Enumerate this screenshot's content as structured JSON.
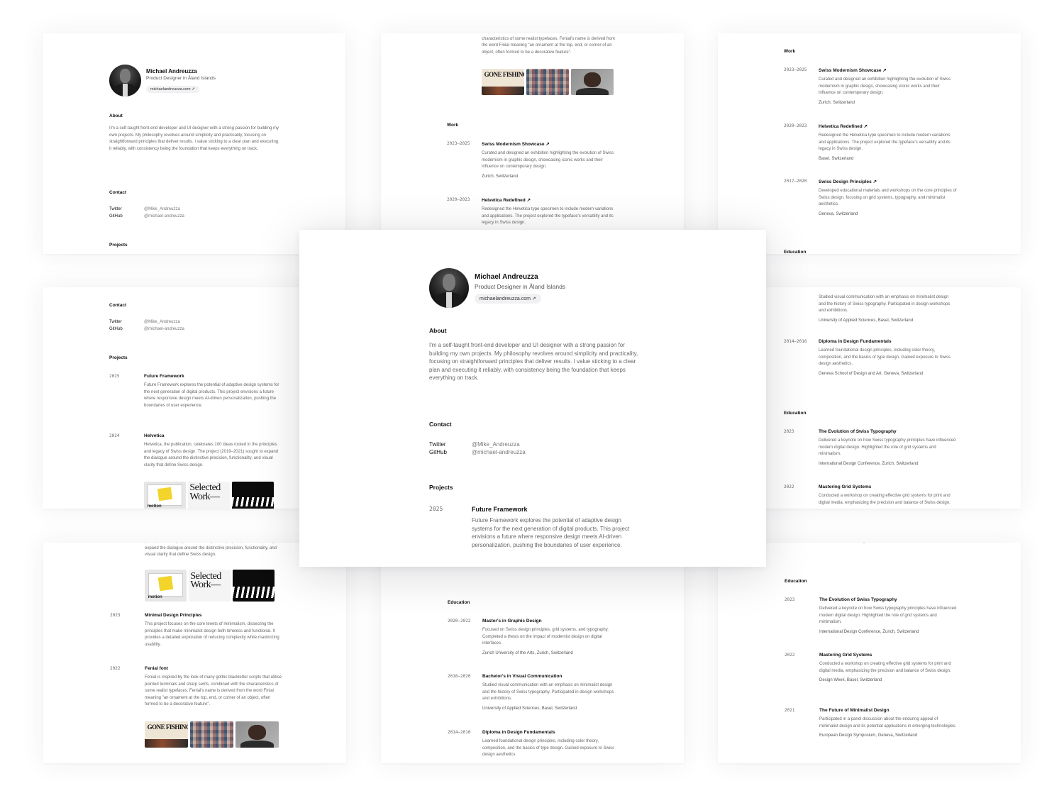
{
  "profile": {
    "name": "Michael Andreuzza",
    "role": "Product Designer in Åland Islands",
    "link": "michaelandreuzza.com ↗"
  },
  "sections": {
    "about": "About",
    "contact": "Contact",
    "projects": "Projects",
    "work": "Work",
    "education": "Education"
  },
  "about": {
    "text": "I'm a self-taught front-end developer and UI designer with a strong passion for building my own projects. My philosophy revolves around simplicity and practicality, focusing on straightforward principles that deliver results. I value sticking to a clear plan and executing it reliably, with consistency being the foundation that keeps everything on track."
  },
  "contact": {
    "twitter_label": "Twitter",
    "twitter_value": "@Mike_Andreuzza",
    "github_label": "GitHub",
    "github_value": "@michael-andreuzza"
  },
  "projects": [
    {
      "year": "2025",
      "title": "Future Framework",
      "desc": "Future Framework explores the potential of adaptive design systems for the next generation of digital products. This project envisions a future where responsive design meets AI-driven personalization, pushing the boundaries of user experience."
    },
    {
      "year": "2024",
      "title": "Helvetica",
      "desc": "Helvetica, the publication, celebrates 100 ideas rooted in the principles and legacy of Swiss design. The project (2019–2021) sought to expand the dialogue around the distinctive precision, functionality, and visual clarity that define Swiss design.",
      "desc_top": "principles and legacy of Swiss design. The project (2019–2021) sought to expand the dialogue around the distinctive precision, functionality, and visual clarity that define Swiss design."
    },
    {
      "year": "2023",
      "title": "Minimal Design Principles",
      "desc": "This project focuses on the core tenets of minimalism, dissecting the principles that make minimalist design both timeless and functional. It provides a detailed exploration of reducing complexity while maximizing usability."
    },
    {
      "year": "2022",
      "title": "Fenial font",
      "desc": "Fenial is inspired by the look of many gothic blackletter scripts that utilise pointed terminals and sharp serifs, combined with the characteristics of some realist typefaces. Fenial's name is derived from the word Finial meaning \"an ornament at the top, end, or corner of an object, often formed to be a decorative feature\".",
      "desc_top": "scripts that utilise pointed terminals and sharp serifs, combined with the characteristics of some realist typefaces. Fenial's name is derived from the word Finial meaning \"an ornament at the top, end, or corner of an object, often formed to be a decorative feature\"."
    }
  ],
  "images": {
    "gone_fishing": "GONE FISHING",
    "motion": "motion",
    "selected_work": "Selected Work—"
  },
  "work": [
    {
      "year": "2023–2025",
      "title": "Swiss Modernism Showcase ↗",
      "desc": "Curated and designed an exhibition highlighting the evolution of Swiss modernism in graphic design, showcasing iconic works and their influence on contemporary design.",
      "loc": "Zurich, Switzerland"
    },
    {
      "year": "2020–2023",
      "title": "Helvetica Redefined ↗",
      "desc": "Redesigned the Helvetica type specimen to include modern variations and applications. The project explored the typeface's versatility and its legacy in Swiss design.",
      "loc": "Basel, Switzerland"
    },
    {
      "year": "2017–2020",
      "title": "Swiss Design Principles ↗",
      "desc": "Developed educational materials and workshops on the core principles of Swiss design, focusing on grid systems, typography, and minimalist aesthetics.",
      "loc": "Geneva, Switzerland"
    }
  ],
  "education": [
    {
      "year": "2020–2022",
      "title": "Master's in Graphic Design",
      "desc": "Focused on Swiss design principles, grid systems, and typography. Completed a thesis on the impact of modernist design on digital interfaces.",
      "loc": "Zurich University of the Arts, Zurich, Switzerland"
    },
    {
      "year": "2016–2020",
      "title": "Bachelor's in Visual Communication",
      "desc": "Studied visual communication with an emphasis on minimalist design and the history of Swiss typography. Participated in design workshops and exhibitions.",
      "loc": "University of Applied Sciences, Basel, Switzerland"
    },
    {
      "year": "2014–2016",
      "title": "Diploma in Design Fundamentals",
      "desc": "Learned foundational design principles, including color theory, composition, and the basics of type design. Gained exposure to Swiss design aesthetics.",
      "loc": "Geneva School of Design and Art, Geneva, Switzerland"
    }
  ],
  "talks": [
    {
      "year": "2023",
      "title": "The Evolution of Swiss Typography",
      "desc": "Delivered a keynote on how Swiss typography principles have influenced modern digital design. Highlighted the role of grid systems and minimalism.",
      "loc": "International Design Conference, Zurich, Switzerland"
    },
    {
      "year": "2022",
      "title": "Mastering Grid Systems",
      "desc": "Conducted a workshop on creating effective grid systems for print and digital media, emphasizing the precision and balance of Swiss design.",
      "loc": "Design Week, Basel, Switzerland"
    },
    {
      "year": "2021",
      "title": "The Future of Minimalist Design",
      "desc": "Participated in a panel discussion about the enduring appeal of minimalist design and its potential applications in emerging technologies.",
      "loc": "European Design Symposium, Geneva, Switzerland"
    }
  ]
}
